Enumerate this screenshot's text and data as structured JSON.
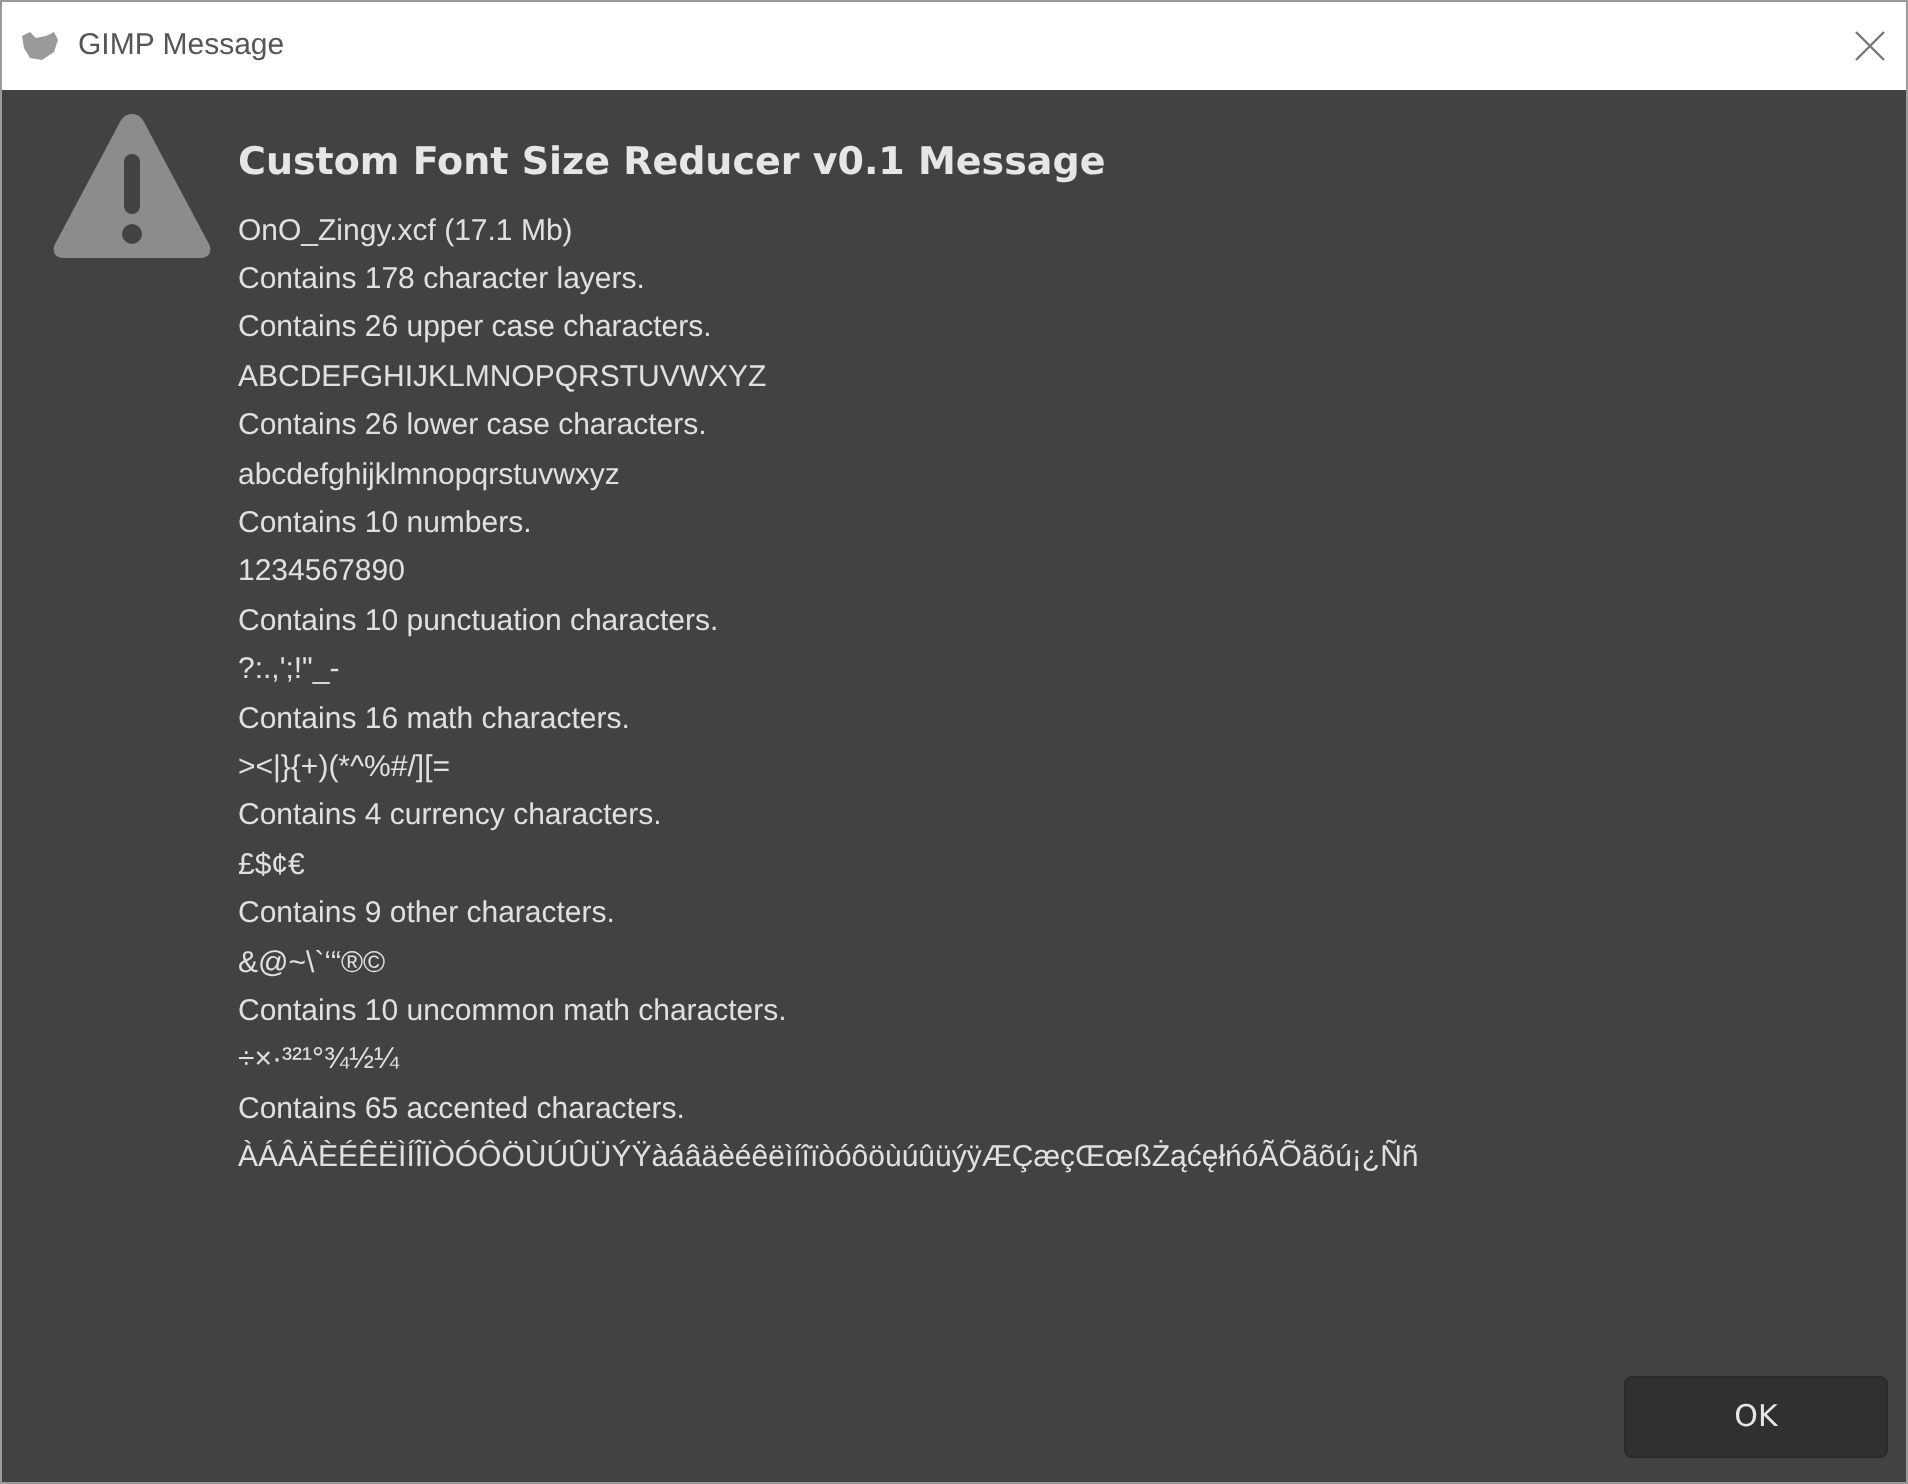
{
  "window": {
    "title": "GIMP Message"
  },
  "message": {
    "heading": "Custom Font Size Reducer v0.1 Message",
    "lines": [
      "OnO_Zingy.xcf (17.1 Mb)",
      "Contains 178 character layers.",
      "Contains 26 upper case characters.",
      "ABCDEFGHIJKLMNOPQRSTUVWXYZ",
      "Contains 26 lower case characters.",
      "abcdefghijklmnopqrstuvwxyz",
      "Contains 10 numbers.",
      "1234567890",
      "Contains 10 punctuation characters.",
      "?:.,';!\"_-",
      "Contains 16 math characters.",
      "><|}{+)(*^%#/][=",
      "Contains 4 currency characters.",
      "£$¢€",
      "Contains 9 other characters.",
      "&@~\\`‘“®©",
      "Contains 10 uncommon math characters.",
      "÷×·³²¹°¾½¼",
      "Contains 65 accented characters.",
      "ÀÁÂÄÈÉÊËÌÍÎÏÒÓÔÖÙÚÛÜÝŸàáâäèéêëìíîïòóôöùúûüýÿÆÇæçŒœßŻąćęłńóÃÕãõú¡¿Ññ"
    ]
  },
  "buttons": [
    "OK"
  ]
}
